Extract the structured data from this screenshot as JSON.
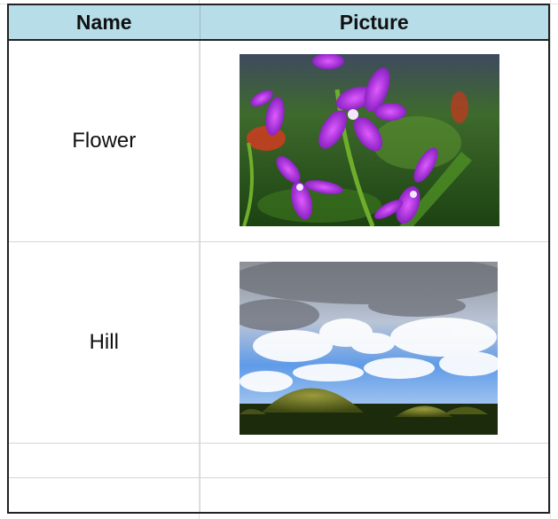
{
  "table": {
    "headers": {
      "name": "Name",
      "picture": "Picture"
    },
    "rows": [
      {
        "name": "Flower",
        "picture_icon": "orchid-photo"
      },
      {
        "name": "Hill",
        "picture_icon": "chocolate-hills-photo"
      },
      {
        "name": "",
        "picture_icon": ""
      },
      {
        "name": "",
        "picture_icon": ""
      }
    ]
  },
  "colors": {
    "header_fill": "#b7dde8",
    "border": "#222222",
    "gridline": "#d6d6d6"
  }
}
